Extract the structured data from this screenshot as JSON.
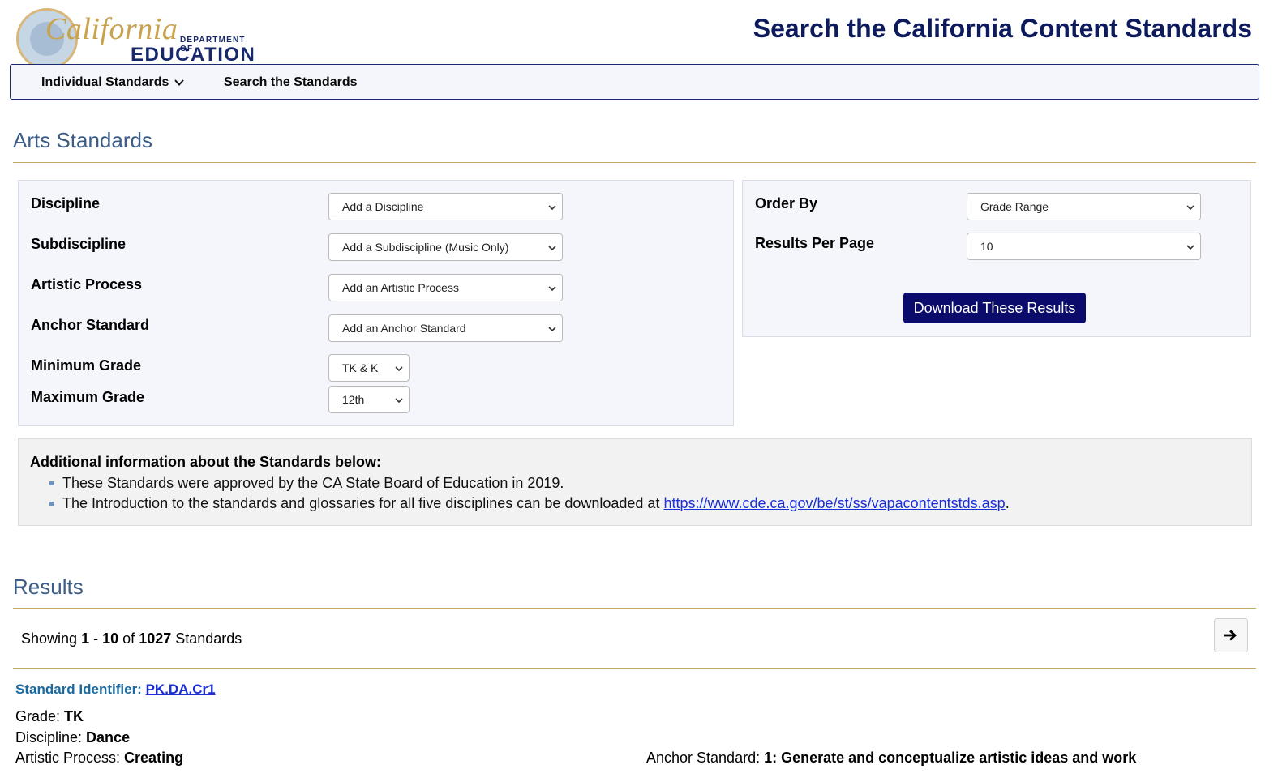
{
  "header": {
    "logo_script": "California",
    "logo_dept": "DEPARTMENT OF",
    "logo_edu": "EDUCATION",
    "site_title": "Search the California Content Standards"
  },
  "nav": {
    "items": [
      {
        "label": "Individual Standards",
        "icon": "chevron-down-icon"
      },
      {
        "label": "Search the Standards"
      }
    ]
  },
  "arts": {
    "title": "Arts Standards",
    "filters": [
      {
        "label": "Discipline",
        "value": "Add a Discipline"
      },
      {
        "label": "Subdiscipline",
        "value": "Add a Subdiscipline (Music Only)"
      },
      {
        "label": "Artistic Process",
        "value": "Add an Artistic Process"
      },
      {
        "label": "Anchor Standard",
        "value": "Add an Anchor Standard"
      },
      {
        "label": "Minimum Grade",
        "value": "TK & K"
      },
      {
        "label": "Maximum Grade",
        "value": "12th"
      }
    ],
    "order": {
      "order_by_label": "Order By",
      "order_by_value": "Grade Range",
      "per_page_label": "Results Per Page",
      "per_page_value": "10",
      "download_label": "Download These Results"
    },
    "info": {
      "title": "Additional information about the Standards below:",
      "item1": "These Standards were approved by the CA State Board of Education in 2019.",
      "item2_pre": "The Introduction to the standards and glossaries for all five disciplines can be downloaded at ",
      "item2_link": "https://www.cde.ca.gov/be/st/ss/vapacontentstds.asp",
      "item2_post": "."
    }
  },
  "results": {
    "title": "Results",
    "showing_word": "Showing",
    "from": "1",
    "dash": "-",
    "to": "10",
    "of_word": "of",
    "total": "1027",
    "unit": "Standards",
    "next_icon": "arrow-right-icon",
    "first": {
      "id_label": "Standard Identifier:",
      "id_value": "PK.DA.Cr1",
      "grade_label": "Grade:",
      "grade_value": "TK",
      "discipline_label": "Discipline:",
      "discipline_value": "Dance",
      "process_label": "Artistic Process:",
      "process_value": "Creating",
      "anchor_label": "Anchor Standard:",
      "anchor_value": "1: Generate and conceptualize artistic ideas and work"
    }
  }
}
